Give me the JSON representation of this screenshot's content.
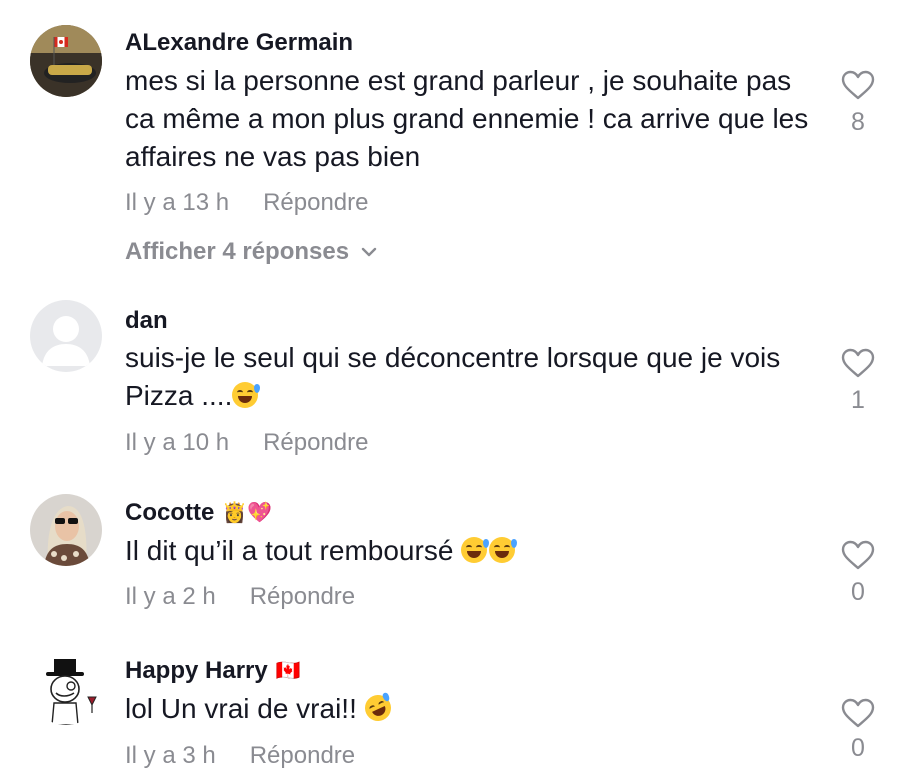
{
  "comments": [
    {
      "username": "ALexandre Germain",
      "badge": "",
      "text": "mes si la personne est grand parleur , je souhaite pas ca même a mon plus grand ennemie ! ca arrive que les affaires ne vas pas bien",
      "time": "Il y a 13 h",
      "reply": "Répondre",
      "likes": "8",
      "view_replies": "Afficher 4 réponses",
      "avatar": "car-photo-canada-flag"
    },
    {
      "username": "dan",
      "badge": "",
      "text": "suis-je le seul qui se déconcentre lorsque que je vois Pizza ....",
      "emoji": "😂",
      "time": "Il y a 10 h",
      "reply": "Répondre",
      "likes": "1",
      "avatar": "default-avatar"
    },
    {
      "username": "Cocotte",
      "badge": "👸💖",
      "text": "Il dit qu’il a tout remboursé",
      "emoji": "😅😅",
      "time": "Il y a 2 h",
      "reply": "Répondre",
      "likes": "0",
      "avatar": "woman-sunglasses-photo"
    },
    {
      "username": "Happy Harry",
      "badge": "🇨🇦",
      "text": "lol Un vrai de vrai!!",
      "emoji": "🤣",
      "time": "Il y a 3 h",
      "reply": "Répondre",
      "likes": "0",
      "avatar": "top-hat-meme-drawing"
    }
  ],
  "colors": {
    "text": "#161823",
    "secondary": "#8a8b91",
    "background": "#ffffff"
  }
}
